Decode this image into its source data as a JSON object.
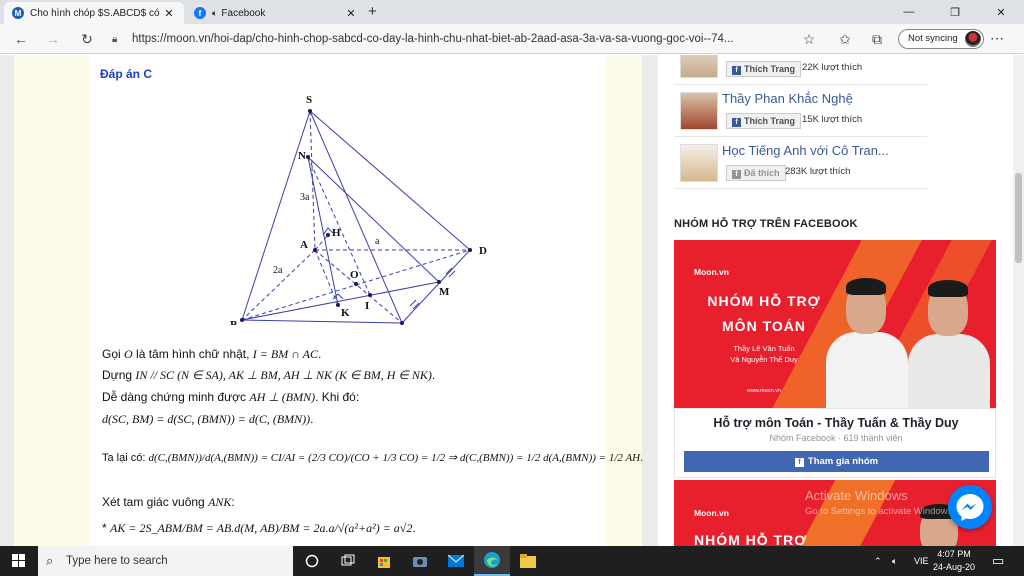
{
  "browser": {
    "tabs": [
      {
        "title": "Cho hình chóp $S.ABCD$ có đáy",
        "active": true,
        "favicon_color": "#1a5fb4"
      },
      {
        "title": "Facebook",
        "active": false,
        "favicon_color": "#1877f2"
      }
    ],
    "url": "https://moon.vn/hoi-dap/cho-hinh-chop-sabcd-co-day-la-hinh-chu-nhat-biet-ab-2aad-asa-3a-va-sa-vuong-goc-voi--74...",
    "profile_label": "Not syncing"
  },
  "solution": {
    "answer_label": "Đáp án C",
    "figure_labels": {
      "S": "S",
      "N": "N",
      "A": "A",
      "H": "H",
      "B": "B",
      "C": "C",
      "D": "D",
      "O": "O",
      "K": "K",
      "I": "I",
      "M": "M",
      "sa": "3a",
      "ab": "2a",
      "ad": "a"
    },
    "lines": [
      {
        "pre": "Gọi ",
        "math": "O",
        "post": " là tâm hình chữ nhật, ",
        "math2": "I = BM ∩ AC",
        "post2": "."
      },
      {
        "pre": "Dựng ",
        "math": "IN // SC (N ∈ SA),  AK ⊥ BM, AH ⊥ NK  (K ∈ BM, H ∈ NK)",
        "post": ".",
        "math2": "",
        "post2": ""
      },
      {
        "pre": "Dễ dàng chứng minh được ",
        "math": "AH ⊥ (BMN)",
        "post": ". Khi đó:",
        "math2": "",
        "post2": ""
      },
      {
        "pre": "",
        "math": "d(SC, BM) = d(SC, (BMN)) = d(C, (BMN))",
        "post": ".",
        "math2": "",
        "post2": ""
      },
      {
        "pre": "Ta lại có: ",
        "math": "d(C,(BMN))/d(A,(BMN)) = CI/AI = (2/3 CO)/(CO + 1/3 CO) = 1/2 ⇒ d(C,(BMN)) = 1/2 d(A,(BMN)) = 1/2 AH",
        "post": ".",
        "math2": "",
        "post2": ""
      },
      {
        "pre": "Xét tam giác vuông ",
        "math": "ANK",
        "post": ":",
        "math2": "",
        "post2": ""
      },
      {
        "pre": "* ",
        "math": "AK = 2S_ABM/BM = AB.d(M, AB)/BM = 2a.a/√(a²+a²) = a√2",
        "post": ".",
        "math2": "",
        "post2": ""
      }
    ]
  },
  "sidebar": {
    "pages": [
      {
        "name": "",
        "button": "Thích Trang",
        "likes": "22K lượt thích",
        "liked": false
      },
      {
        "name": "Thầy Phan Khắc Nghệ",
        "button": "Thích Trang",
        "likes": "15K lượt thích",
        "liked": false
      },
      {
        "name": "Học Tiếng Anh với Cô Tran...",
        "button": "Đã thích",
        "likes": "283K lượt thích",
        "liked": true
      }
    ],
    "section_title": "NHÓM HỖ TRỢ TRÊN FACEBOOK",
    "banner": {
      "brand": "Moon.vn",
      "headline_line1": "NHÓM HỖ TRỢ",
      "headline_line2": "MÔN TOÁN",
      "subtitle_line1": "Thầy Lê Văn Tuấn",
      "subtitle_line2": "Và Nguyễn Thế Duy",
      "website": "www.moon.vn"
    },
    "group": {
      "title": "Hỗ trợ môn Toán - Thầy Tuấn & Thầy Duy",
      "meta": "Nhóm Facebook · 619 thành viên",
      "join_label": "Tham gia nhóm"
    },
    "banner2": {
      "brand": "Moon.vn",
      "headline": "NHÓM HỖ TRỢ"
    },
    "watermark_line1": "Activate Windows",
    "watermark_line2": "Go to Settings to activate Windows."
  },
  "taskbar": {
    "search_placeholder": "Type here to search",
    "language": "VIE",
    "time": "4:07 PM",
    "date": "24-Aug-20"
  }
}
